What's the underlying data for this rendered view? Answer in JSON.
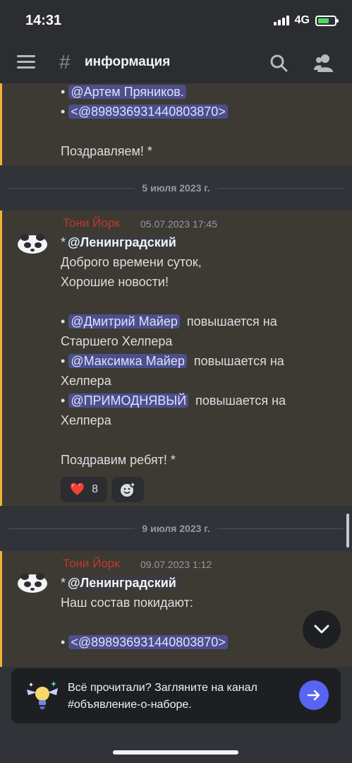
{
  "status": {
    "time": "14:31",
    "network": "4G"
  },
  "header": {
    "channel_name": "информация"
  },
  "message_tail": {
    "line1_bullet": "•",
    "line1_mention": "@Артем Пряников.",
    "line2_bullet": "•",
    "line2_mention": "<@898936931440803870>",
    "closing": "Поздравляем! *"
  },
  "dividers": [
    {
      "date": "5 июля 2023 г."
    },
    {
      "date": "9 июля 2023 г."
    }
  ],
  "message1": {
    "author": "Тони Йорк",
    "timestamp": "05.07.2023 17:45",
    "mention_prefix": "*",
    "mention": "@Ленинградский",
    "line_greeting": "Доброго времени суток,",
    "line_news": "Хорошие новости!",
    "bullet": "•",
    "item1_mention": "@Дмитрий Майер",
    "item1_text": "повышается на",
    "item1_cont": "Старшего Хелпера",
    "item2_mention": "@Максимка Майер",
    "item2_text": "повышается на",
    "item2_cont": "Хелпера",
    "item3_mention": "@ПРИМОДНЯВЫЙ",
    "item3_text": "повышается на",
    "item3_cont": "Хелпера",
    "closing": "Поздравим ребят! *",
    "reactions": [
      {
        "emoji": "❤️",
        "count": "8"
      }
    ]
  },
  "message2": {
    "author": "Тони Йорк",
    "timestamp": "09.07.2023 1:12",
    "mention_prefix": "*",
    "mention": "@Ленинградский",
    "line1": "Наш состав покидают:",
    "bullet": "•",
    "item1_mention": "<@898936931440803870>"
  },
  "banner": {
    "text": "Всё прочитали? Загляните на канал #объявление-о-наборе."
  },
  "colors": {
    "accent": "#5865f2",
    "highlight_bar": "#f0b232",
    "author": "#c0392b",
    "mention_bg": "#4c4f8c"
  }
}
